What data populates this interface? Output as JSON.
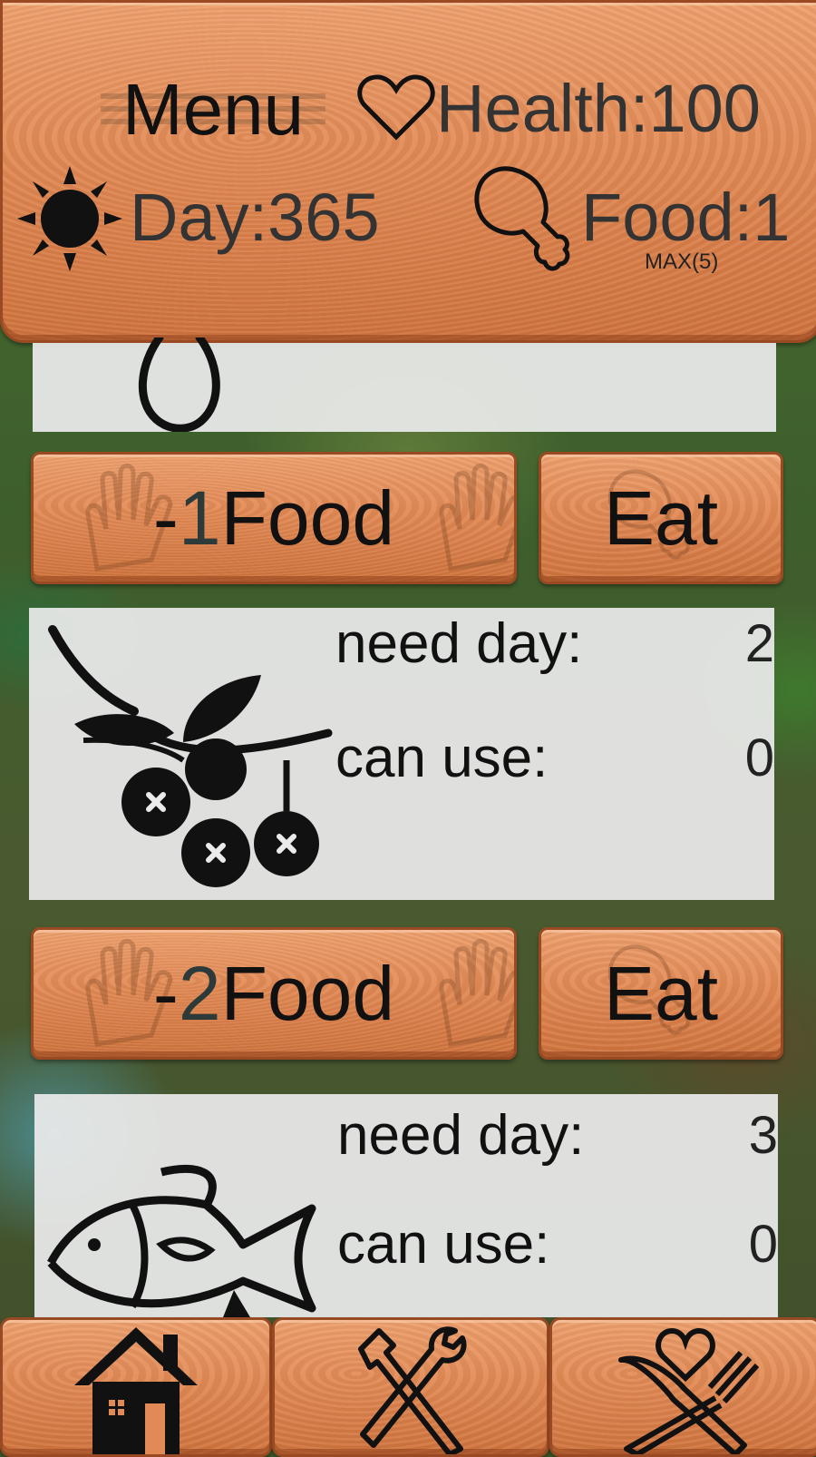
{
  "hud": {
    "menu_label": "Menu",
    "health_label": "Health:100",
    "day_label": "Day:365",
    "food_label": "Food:1",
    "food_max_label": "MAX(5)"
  },
  "recipes": [
    {
      "icon": "rope-icon",
      "cost_prefix": "-",
      "cost_number": "1",
      "cost_suffix": "Food",
      "eat_label": "Eat"
    },
    {
      "icon": "berries-icon",
      "need_day_label": "need day:",
      "need_day_value": "2",
      "can_use_label": "can use:",
      "can_use_value": "0",
      "cost_prefix": "-",
      "cost_number": "2",
      "cost_suffix": "Food",
      "eat_label": "Eat"
    },
    {
      "icon": "fish-icon",
      "need_day_label": "need day:",
      "need_day_value": "3",
      "can_use_label": "can use:",
      "can_use_value": "0"
    }
  ],
  "nav": {
    "items": [
      "home-icon",
      "tools-icon",
      "food-heart-icon"
    ]
  },
  "colors": {
    "wood": "#e28a55",
    "wood_border": "#9a4a22",
    "panel": "#ebebeb",
    "text_dark": "#333333"
  }
}
